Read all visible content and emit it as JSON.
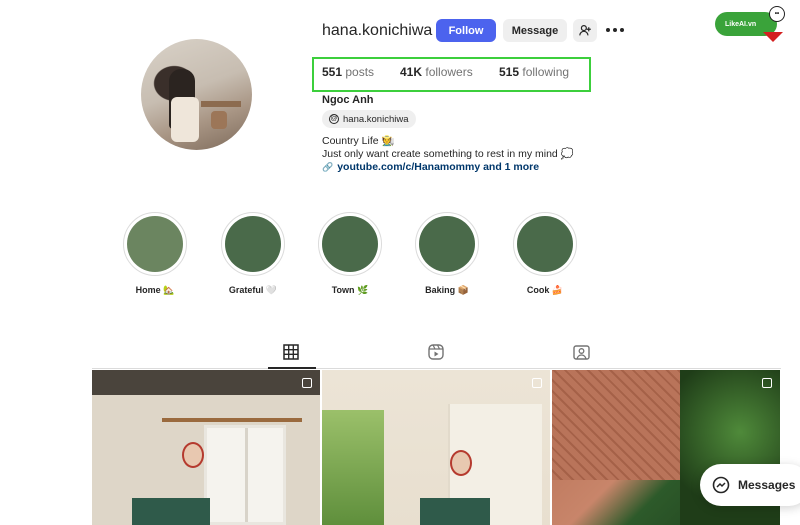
{
  "profile": {
    "username": "hana.konichiwa",
    "full_name": "Ngoc Anh",
    "threads_handle": "hana.konichiwa",
    "bio_lines": [
      "Country Life 🧑‍🌾",
      "Just only want create something to rest in my mind 💭"
    ],
    "link_text": "youtube.com/c/Hanamommy and 1 more"
  },
  "actions": {
    "follow_label": "Follow",
    "message_label": "Message"
  },
  "stats": {
    "posts_count": "551",
    "posts_label": "posts",
    "followers_count": "41K",
    "followers_label": "followers",
    "following_count": "515",
    "following_label": "following"
  },
  "highlights": [
    {
      "name": "Home 🏡"
    },
    {
      "name": "Grateful 🤍"
    },
    {
      "name": "Town 🌿"
    },
    {
      "name": "Baking 📦"
    },
    {
      "name": "Cook 🍰"
    }
  ],
  "tabs": [
    "grid-icon",
    "reels-icon",
    "tagged-icon"
  ],
  "watermark": {
    "text": "LikeAI.vn"
  },
  "messages_label": "Messages",
  "colors": {
    "follow_button": "#4c63ee",
    "highlight_box": "#3ccf3c"
  }
}
